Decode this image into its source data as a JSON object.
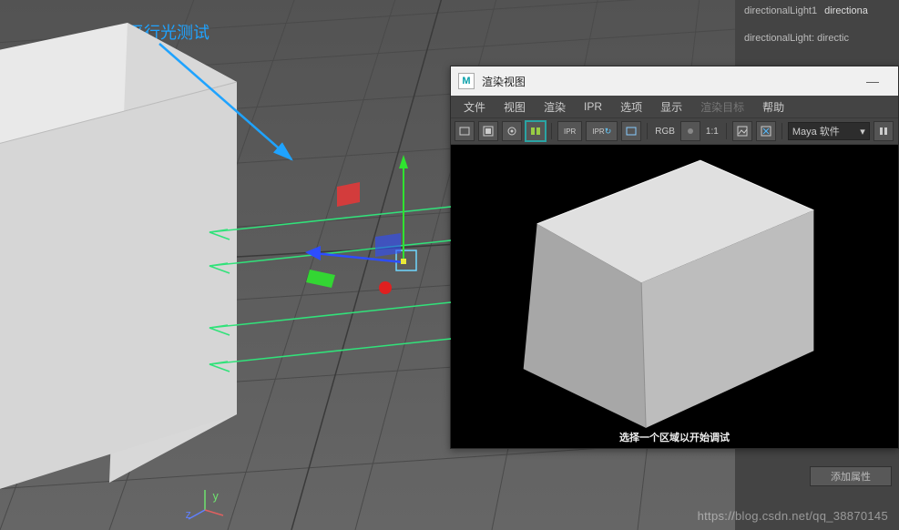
{
  "annotation": {
    "text": "平行光测试"
  },
  "axes": {
    "y": "y",
    "z": "z"
  },
  "attribute_panel": {
    "tabs": [
      "directionalLight1",
      "directiona"
    ],
    "node_line": "directionalLight:   directic",
    "add_attr_btn": "添加属性"
  },
  "render_window": {
    "title": "渲染视图",
    "win_controls": {
      "minimize": "—"
    },
    "menus": [
      {
        "label": "文件",
        "dim": false
      },
      {
        "label": "视图",
        "dim": false
      },
      {
        "label": "渲染",
        "dim": false
      },
      {
        "label": "IPR",
        "dim": false
      },
      {
        "label": "选项",
        "dim": false
      },
      {
        "label": "显示",
        "dim": false
      },
      {
        "label": "渲染目标",
        "dim": true
      },
      {
        "label": "帮助",
        "dim": false
      }
    ],
    "toolbar": {
      "rgb_label": "RGB",
      "ratio_label": "1:1",
      "ipr_label_a": "IPR",
      "ipr_label_b": "IPR",
      "renderer": "Maya 软件"
    },
    "status": "选择一个区域以开始调试"
  },
  "watermark": "https://blog.csdn.net/qq_38870145"
}
